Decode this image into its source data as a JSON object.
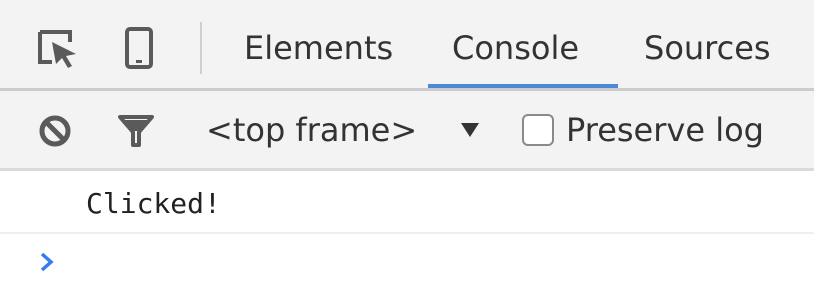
{
  "tabbar": {
    "icons": [
      "inspect-element-icon",
      "device-mode-icon"
    ],
    "tabs": [
      {
        "label": "Elements"
      },
      {
        "label": "Console"
      },
      {
        "label": "Sources"
      }
    ],
    "active_tab": "Console",
    "accent_color": "#4c8ad9"
  },
  "toolbar": {
    "icons": [
      "clear-console-icon",
      "filter-icon",
      "dropdown-arrow-icon"
    ],
    "context": "<top frame>",
    "preserve_log_label": "Preserve log",
    "preserve_log_checked": false
  },
  "console": {
    "messages": [
      "Clicked!"
    ],
    "prompt_icon": "prompt-chevron-icon",
    "prompt_color": "#367cf1"
  }
}
